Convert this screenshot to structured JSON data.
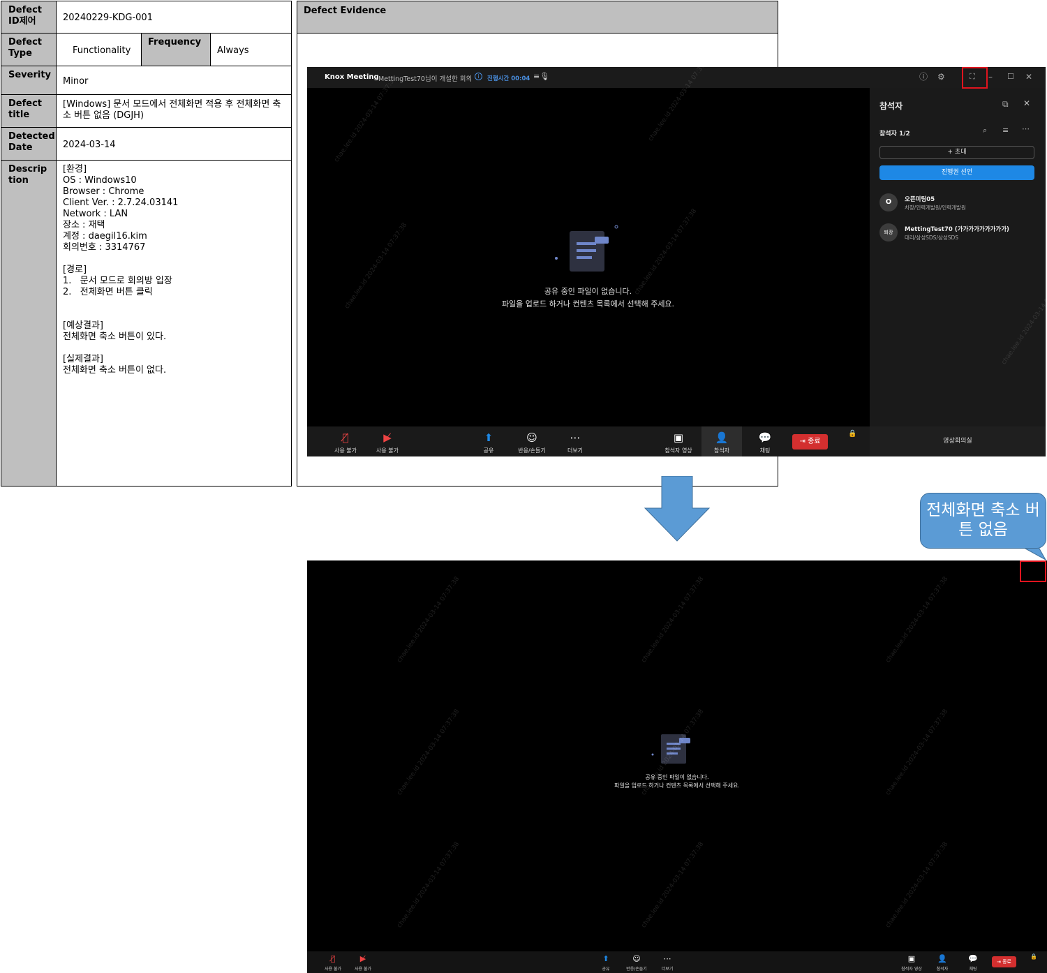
{
  "defect": {
    "id_label": "Defect ID제어",
    "id_value": "20240229-KDG-001",
    "type_label": "Defect Type",
    "type_value": "Functionality",
    "frequency_label": "Frequency",
    "frequency_value": "Always",
    "severity_label": "Severity",
    "severity_value": "Minor",
    "title_label": "Defect title",
    "title_value": "[Windows] 문서 모드에서 전체화면 적용 후 전체화면 축소 버튼 없음 (DGJH)",
    "date_label": "Detected Date",
    "date_value": "2024-03-14",
    "desc_label": "Description",
    "description_lines": [
      "[환경]",
      "OS : Windows10",
      "Browser : Chrome",
      "Client Ver. : 2.7.24.03141",
      "Network : LAN",
      "장소 : 재택",
      "계정 : daegil16.kim",
      "회의번호 : 3314767",
      "",
      "[경로]",
      "1.   문서 모드로 회의방 입장",
      "2.   전체화면 버튼 클릭",
      "",
      "",
      "[예상결과]",
      "전체화면 축소 버튼이 있다.",
      "",
      "[실제결과]",
      "전체화면 축소 버튼이 없다."
    ]
  },
  "evidence": {
    "header": "Defect  Evidence",
    "window": {
      "brand": "Knox  Meeting",
      "subject": "MettingTest70님이 개설한 회의",
      "elapsed": "진행시간 00:04",
      "empty_line1": "공유 중인 파일이 없습니다.",
      "empty_line2": "파일을 업로드 하거나 컨텐츠 목록에서 선택해 주세요.",
      "watermark": "chae.lee.id 2024-03-14 07:37:38",
      "toolbar": {
        "mic": "사용 불가",
        "video": "사용 불가",
        "share": "공유",
        "reaction": "반응/손들기",
        "more": "더보기",
        "participant_video": "참석자 영상",
        "participants": "참석자",
        "chat": "채팅",
        "end": "종료"
      },
      "sidebar": {
        "title": "참석자",
        "count_label": "참석자",
        "count_value": "1/2",
        "invite": "+ 초대",
        "host_declare": "진행권 선언",
        "participants": [
          {
            "avatar": "O",
            "name": "오픈미팅05",
            "dept": "차장/인력개발원/인력개발원"
          },
          {
            "avatar": "퇴장",
            "name": "MettingTest70 (가가가가가가가가가)",
            "dept": "대리/삼성SDS/삼성SDS"
          }
        ],
        "footer": "영상회의실"
      }
    },
    "callout": "전체화면 축소 버튼 없음"
  },
  "colors": {
    "label_bg": "#bfbfbf",
    "accent_blue": "#1e88e5",
    "end_red": "#d32f2f",
    "highlight_red": "#e0141e",
    "callout_blue": "#5b9bd5",
    "arrow_blue": "#5b9bd5"
  },
  "icons": {
    "help": "help-icon",
    "settings": "gear-icon",
    "fullscreen": "fullscreen-icon",
    "minimize": "minimize-icon",
    "maximize": "maximize-icon",
    "close": "close-icon",
    "arrow": "down-arrow"
  }
}
